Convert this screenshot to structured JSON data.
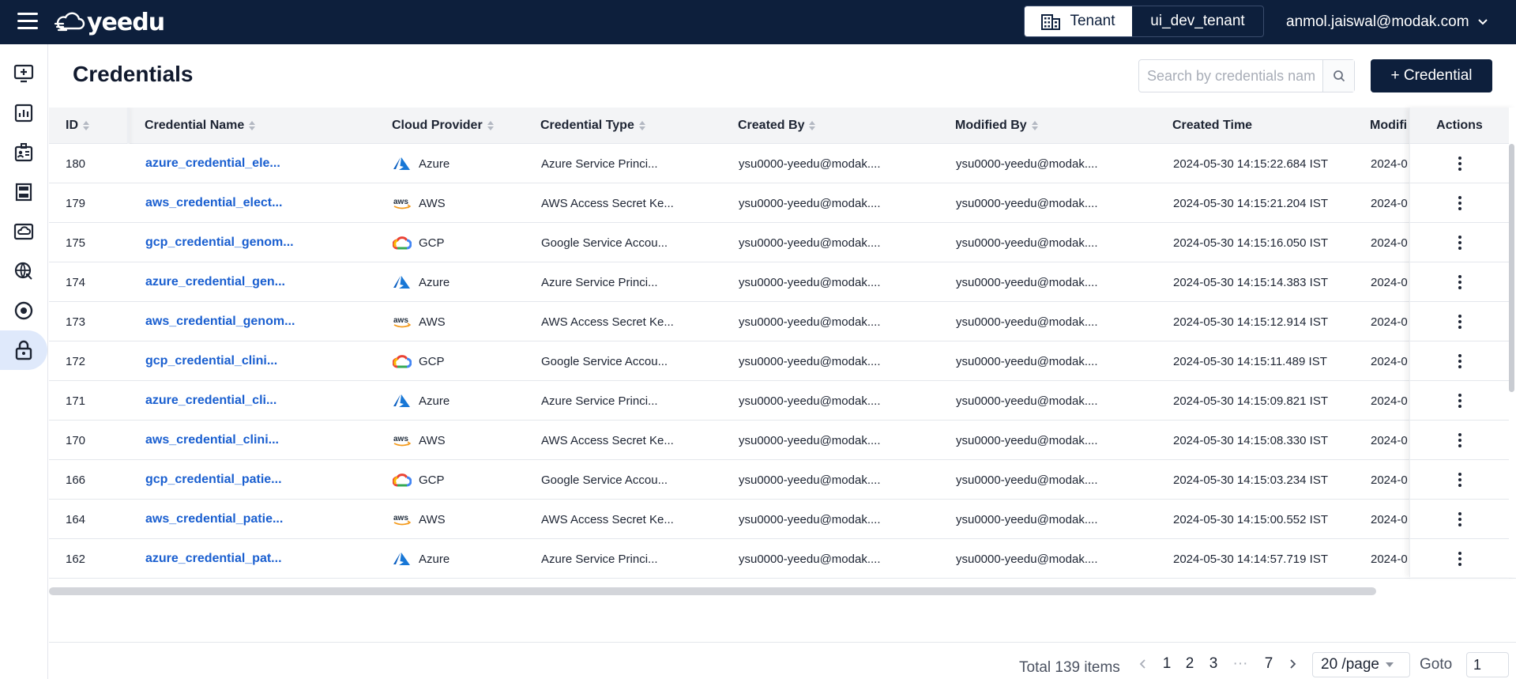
{
  "header": {
    "logo_text": "yeedu",
    "tenant_label": "Tenant",
    "tenant_name": "ui_dev_tenant",
    "user_email": "anmol.jaiswal@modak.com"
  },
  "sidebar": {
    "items": [
      {
        "icon": "monitor-add-icon"
      },
      {
        "icon": "bar-chart-icon"
      },
      {
        "icon": "id-card-icon"
      },
      {
        "icon": "server-rack-icon"
      },
      {
        "icon": "cloud-box-icon"
      },
      {
        "icon": "globe-network-icon"
      },
      {
        "icon": "target-icon"
      },
      {
        "icon": "lock-icon",
        "active": true
      }
    ]
  },
  "page": {
    "title": "Credentials",
    "search_placeholder": "Search by credentials name",
    "add_button_label": "+ Credential"
  },
  "table": {
    "columns": {
      "id": "ID",
      "name": "Credential Name",
      "provider": "Cloud Provider",
      "type": "Credential Type",
      "created_by": "Created By",
      "modified_by": "Modified By",
      "created_time": "Created Time",
      "modified_time": "Modifi",
      "actions": "Actions"
    },
    "rows": [
      {
        "id": "180",
        "name": "azure_credential_ele...",
        "provider": "Azure",
        "type": "Azure Service Princi...",
        "created_by": "ysu0000-yeedu@modak....",
        "modified_by": "ysu0000-yeedu@modak....",
        "created_time": "2024-05-30 14:15:22.684 IST",
        "modified_time": "2024-0"
      },
      {
        "id": "179",
        "name": "aws_credential_elect...",
        "provider": "AWS",
        "type": "AWS Access Secret Ke...",
        "created_by": "ysu0000-yeedu@modak....",
        "modified_by": "ysu0000-yeedu@modak....",
        "created_time": "2024-05-30 14:15:21.204 IST",
        "modified_time": "2024-0"
      },
      {
        "id": "175",
        "name": "gcp_credential_genom...",
        "provider": "GCP",
        "type": "Google Service Accou...",
        "created_by": "ysu0000-yeedu@modak....",
        "modified_by": "ysu0000-yeedu@modak....",
        "created_time": "2024-05-30 14:15:16.050 IST",
        "modified_time": "2024-0"
      },
      {
        "id": "174",
        "name": "azure_credential_gen...",
        "provider": "Azure",
        "type": "Azure Service Princi...",
        "created_by": "ysu0000-yeedu@modak....",
        "modified_by": "ysu0000-yeedu@modak....",
        "created_time": "2024-05-30 14:15:14.383 IST",
        "modified_time": "2024-0"
      },
      {
        "id": "173",
        "name": "aws_credential_genom...",
        "provider": "AWS",
        "type": "AWS Access Secret Ke...",
        "created_by": "ysu0000-yeedu@modak....",
        "modified_by": "ysu0000-yeedu@modak....",
        "created_time": "2024-05-30 14:15:12.914 IST",
        "modified_time": "2024-0"
      },
      {
        "id": "172",
        "name": "gcp_credential_clini...",
        "provider": "GCP",
        "type": "Google Service Accou...",
        "created_by": "ysu0000-yeedu@modak....",
        "modified_by": "ysu0000-yeedu@modak....",
        "created_time": "2024-05-30 14:15:11.489 IST",
        "modified_time": "2024-0"
      },
      {
        "id": "171",
        "name": "azure_credential_cli...",
        "provider": "Azure",
        "type": "Azure Service Princi...",
        "created_by": "ysu0000-yeedu@modak....",
        "modified_by": "ysu0000-yeedu@modak....",
        "created_time": "2024-05-30 14:15:09.821 IST",
        "modified_time": "2024-0"
      },
      {
        "id": "170",
        "name": "aws_credential_clini...",
        "provider": "AWS",
        "type": "AWS Access Secret Ke...",
        "created_by": "ysu0000-yeedu@modak....",
        "modified_by": "ysu0000-yeedu@modak....",
        "created_time": "2024-05-30 14:15:08.330 IST",
        "modified_time": "2024-0"
      },
      {
        "id": "166",
        "name": "gcp_credential_patie...",
        "provider": "GCP",
        "type": "Google Service Accou...",
        "created_by": "ysu0000-yeedu@modak....",
        "modified_by": "ysu0000-yeedu@modak....",
        "created_time": "2024-05-30 14:15:03.234 IST",
        "modified_time": "2024-0"
      },
      {
        "id": "164",
        "name": "aws_credential_patie...",
        "provider": "AWS",
        "type": "AWS Access Secret Ke...",
        "created_by": "ysu0000-yeedu@modak....",
        "modified_by": "ysu0000-yeedu@modak....",
        "created_time": "2024-05-30 14:15:00.552 IST",
        "modified_time": "2024-0"
      },
      {
        "id": "162",
        "name": "azure_credential_pat...",
        "provider": "Azure",
        "type": "Azure Service Princi...",
        "created_by": "ysu0000-yeedu@modak....",
        "modified_by": "ysu0000-yeedu@modak....",
        "created_time": "2024-05-30 14:14:57.719 IST",
        "modified_time": "2024-0"
      }
    ]
  },
  "pagination": {
    "total_label": "Total 139 items",
    "pages": [
      "1",
      "2",
      "3",
      "···",
      "7"
    ],
    "page_size_label": "20 /page",
    "goto_label": "Goto",
    "goto_value": "1"
  },
  "colors": {
    "topbar": "#0d1f3c",
    "link": "#1a5fd0",
    "active_nav": "#dfe9fb"
  }
}
